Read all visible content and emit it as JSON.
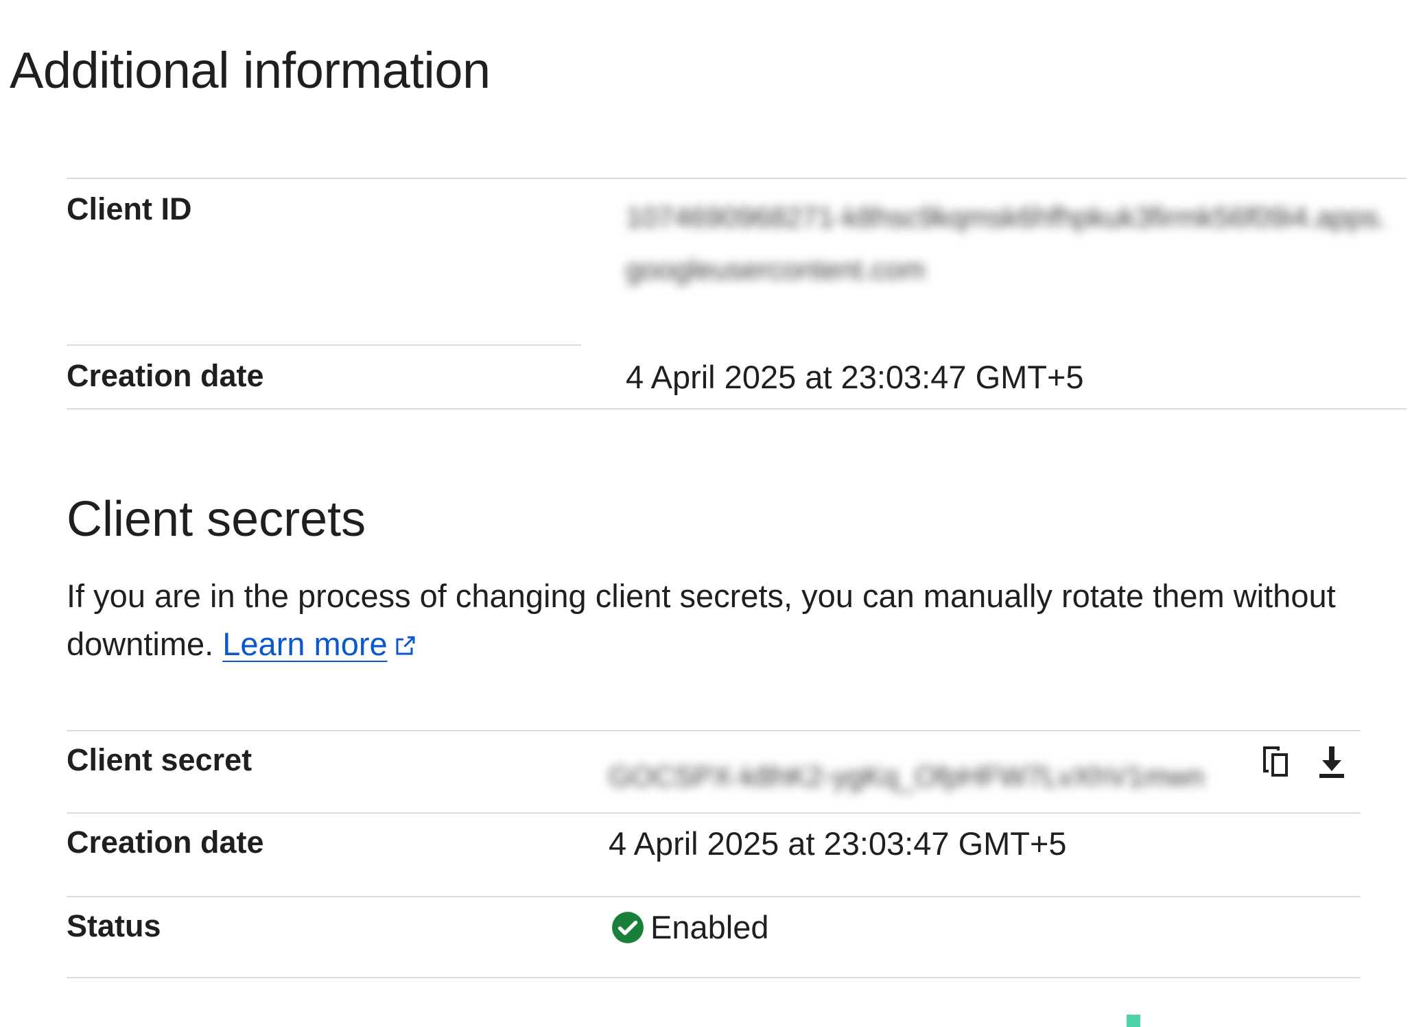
{
  "page": {
    "title": "Additional information"
  },
  "client_info": {
    "client_id_label": "Client ID",
    "client_id_value": "1074690968271-k8hsc9kqmsk6hfhpkuk3firmk56f09i4.apps.googleusercontent.com",
    "creation_date_label": "Creation date",
    "creation_date_value": "4 April 2025 at 23:03:47 GMT+5"
  },
  "client_secrets": {
    "title": "Client secrets",
    "description": "If you are in the process of changing client secrets, you can manually rotate them without downtime.",
    "learn_more": "Learn more",
    "secret_label": "Client secret",
    "secret_value": "GOCSPX-k8hK2-ygKq_OfpHFW7LvXhV1mwn",
    "creation_date_label": "Creation date",
    "creation_date_value": "4 April 2025 at 23:03:47 GMT+5",
    "status_label": "Status",
    "status_value": "Enabled"
  },
  "icons": {
    "copy": "copy-icon",
    "download": "download-icon",
    "status": "check-circle-icon",
    "external_link": "open-in-new-icon"
  },
  "colors": {
    "text": "#1f1f1f",
    "link": "#0b57d0",
    "divider": "#dadce0",
    "status_enabled": "#188038",
    "accent": "#4fd1a9"
  }
}
